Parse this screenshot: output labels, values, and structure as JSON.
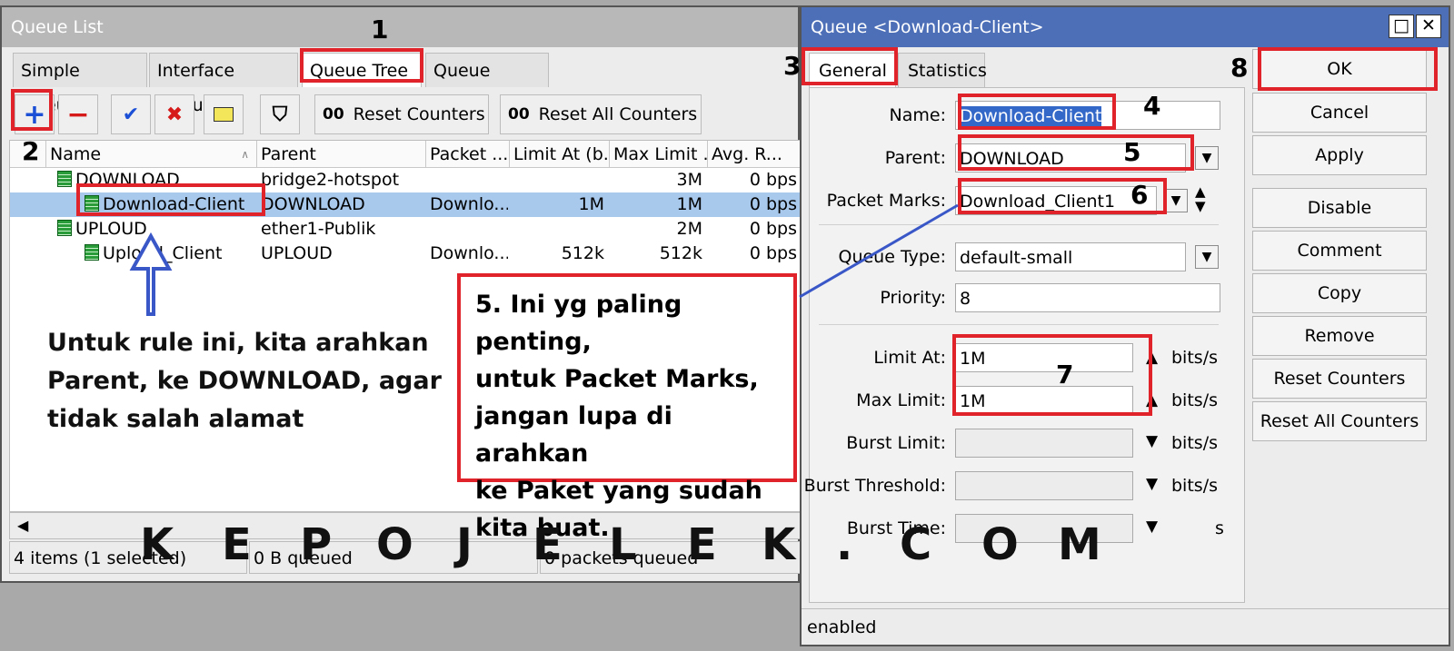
{
  "queue_list": {
    "title": "Queue List",
    "tabs": [
      "Simple Queues",
      "Interface Queues",
      "Queue Tree",
      "Queue Types"
    ],
    "toolbar": {
      "reset_counters": "Reset Counters",
      "reset_all_counters": "Reset All Counters",
      "counter_glyph": "00"
    },
    "columns": [
      "Name",
      "Parent",
      "Packet ...",
      "Limit At (b...",
      "Max Limit ...",
      "Avg. R..."
    ],
    "rows": [
      {
        "name": "DOWNLOAD",
        "parent": "bridge2-hotspot",
        "packet": "",
        "limit_at": "",
        "max_limit": "3M",
        "avg": "0 bps"
      },
      {
        "name": "Download-Client",
        "parent": "DOWNLOAD",
        "packet": "Downlo...",
        "limit_at": "1M",
        "max_limit": "1M",
        "avg": "0 bps"
      },
      {
        "name": "UPLOUD",
        "parent": "ether1-Publik",
        "packet": "",
        "limit_at": "",
        "max_limit": "2M",
        "avg": "0 bps"
      },
      {
        "name": "Uploud_Client",
        "parent": "UPLOUD",
        "packet": "Downlo...",
        "limit_at": "512k",
        "max_limit": "512k",
        "avg": "0 bps"
      }
    ],
    "status": {
      "items": "4 items (1 selected)",
      "queued": "0 B queued",
      "packets": "0 packets queued"
    }
  },
  "dialog": {
    "title": "Queue <Download-Client>",
    "tabs": [
      "General",
      "Statistics"
    ],
    "fields": {
      "name_label": "Name:",
      "name_value": "Download-Client",
      "parent_label": "Parent:",
      "parent_value": "DOWNLOAD",
      "packet_marks_label": "Packet Marks:",
      "packet_marks_value": "Download_Client1",
      "queue_type_label": "Queue Type:",
      "queue_type_value": "default-small",
      "priority_label": "Priority:",
      "priority_value": "8",
      "limit_at_label": "Limit At:",
      "limit_at_value": "1M",
      "max_limit_label": "Max Limit:",
      "max_limit_value": "1M",
      "burst_limit_label": "Burst Limit:",
      "burst_threshold_label": "Burst Threshold:",
      "burst_time_label": "Burst Time:",
      "unit_bits": "bits/s",
      "unit_s": "s"
    },
    "buttons": [
      "OK",
      "Cancel",
      "Apply",
      "Disable",
      "Comment",
      "Copy",
      "Remove",
      "Reset Counters",
      "Reset All Counters"
    ],
    "status": "enabled"
  },
  "annotations": {
    "n1": "1",
    "n2": "2",
    "n3": "3",
    "n4": "4",
    "n5": "5",
    "n6": "6",
    "n7": "7",
    "n8": "8",
    "note_left_1": "Untuk rule ini, kita arahkan",
    "note_left_2": "Parent, ke DOWNLOAD, agar",
    "note_left_3": "tidak salah alamat",
    "callout_1": "5. Ini yg paling penting,",
    "callout_2": "untuk Packet Marks,",
    "callout_3": "jangan lupa di arahkan",
    "callout_4": "ke Paket yang sudah",
    "callout_5": "kita buat.",
    "watermark": [
      "K",
      "E",
      "P",
      "O",
      "J",
      "E",
      "L",
      "E",
      "K",
      ".",
      "C",
      "O",
      "M"
    ]
  },
  "colors": {
    "highlight_red": "#e0222b",
    "arrow_blue": "#3a57c8",
    "title_blue": "#4d6fb8",
    "selected_row": "#a8c8ec"
  }
}
